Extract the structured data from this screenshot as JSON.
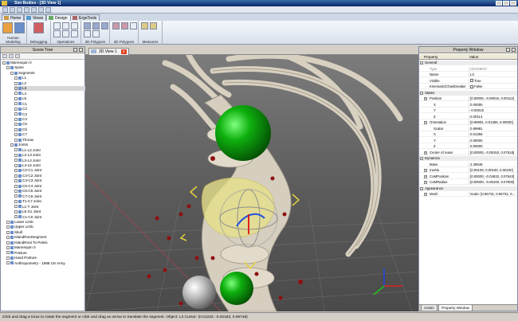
{
  "window": {
    "title": "Sim Bodies - [3D View 1]"
  },
  "tabs": [
    {
      "label": "Home",
      "icon": "home-icon"
    },
    {
      "label": "Views",
      "icon": "views-icon"
    },
    {
      "label": "Design",
      "icon": "design-icon"
    },
    {
      "label": "ErgoTools",
      "icon": "ergotools-icon"
    }
  ],
  "ribbon_groups": [
    "Human Modeling",
    "Debugging",
    "Operations",
    "3D Polygons",
    "3D Polygons",
    "Measures"
  ],
  "scene_tree": {
    "title": "Scene Tree",
    "items": [
      {
        "label": "Mannequin 0",
        "level": 0
      },
      {
        "label": "Spine",
        "level": 1
      },
      {
        "label": "Segments",
        "level": 2
      },
      {
        "label": "L1",
        "level": 3
      },
      {
        "label": "L2",
        "level": 3
      },
      {
        "label": "L3",
        "level": 3,
        "selected": true
      },
      {
        "label": "L4",
        "level": 3
      },
      {
        "label": "L5",
        "level": 3
      },
      {
        "label": "C1",
        "level": 3
      },
      {
        "label": "C2",
        "level": 3
      },
      {
        "label": "C3",
        "level": 3
      },
      {
        "label": "C4",
        "level": 3
      },
      {
        "label": "C5",
        "level": 3
      },
      {
        "label": "C6",
        "level": 3
      },
      {
        "label": "C7",
        "level": 3
      },
      {
        "label": "Thorax",
        "level": 3
      },
      {
        "label": "Joints",
        "level": 2
      },
      {
        "label": "L1-L2 Joint",
        "level": 3
      },
      {
        "label": "L2-L3 Joint",
        "level": 3
      },
      {
        "label": "L3-L4 Joint",
        "level": 3
      },
      {
        "label": "L4-L5 Joint",
        "level": 3
      },
      {
        "label": "C2-C1 Joint",
        "level": 3
      },
      {
        "label": "C3-C2 Joint",
        "level": 3
      },
      {
        "label": "C4-C3 Joint",
        "level": 3
      },
      {
        "label": "C5-C4 Joint",
        "level": 3
      },
      {
        "label": "C6-C5 Joint",
        "level": 3
      },
      {
        "label": "C7-C6 Joint",
        "level": 3
      },
      {
        "label": "T1-C7 Joint",
        "level": 3
      },
      {
        "label": "L1-T Joint",
        "level": 3
      },
      {
        "label": "L5-S1 Joint",
        "level": 3
      },
      {
        "label": "C1-C0 Joint",
        "level": 3
      },
      {
        "label": "Lower Limb",
        "level": 1
      },
      {
        "label": "Upper Limb",
        "level": 1
      },
      {
        "label": "Skull",
        "level": 1
      },
      {
        "label": "IslandRootSegment",
        "level": 1
      },
      {
        "label": "IslandRoot To Pelvis",
        "level": 1
      },
      {
        "label": "Mannequin 0",
        "level": 1
      },
      {
        "label": "Posture",
        "level": 1
      },
      {
        "label": "Hand Posture",
        "level": 1
      },
      {
        "label": "Anthropometry - 1988 US Army",
        "level": 1
      }
    ]
  },
  "view": {
    "tab_label": "3D View 1",
    "close": "x"
  },
  "property_window": {
    "title": "Property Window",
    "col_property": "Property",
    "col_value": "Value",
    "rows": [
      {
        "name": "General",
        "value": "",
        "level": 0,
        "cat": true
      },
      {
        "name": "Type",
        "value": "SEGMENT",
        "level": 1,
        "muted": true
      },
      {
        "name": "Name",
        "value": "L3",
        "level": 1
      },
      {
        "name": "Visible",
        "value": "True",
        "level": 1,
        "check": true
      },
      {
        "name": "Kinematic/Chainbreaker",
        "value": "False",
        "level": 1,
        "check": true
      },
      {
        "name": "States",
        "value": "",
        "level": 0,
        "cat": true
      },
      {
        "name": "Position",
        "value": "[0.00000, -0.00015, 0.00113]",
        "level": 1,
        "exp": true
      },
      {
        "name": "X",
        "value": "0.00000",
        "level": 2
      },
      {
        "name": "Y",
        "value": "-0.00015",
        "level": 2
      },
      {
        "name": "Z",
        "value": "0.00113",
        "level": 2
      },
      {
        "name": "Orientation",
        "value": "[0.99991, 0.01355, 0.00000]",
        "level": 1,
        "exp": true
      },
      {
        "name": "Scalar",
        "value": "0.99991",
        "level": 2
      },
      {
        "name": "X",
        "value": "0.01355",
        "level": 2
      },
      {
        "name": "Y",
        "value": "0.00000",
        "level": 2
      },
      {
        "name": "Z",
        "value": "0.00000",
        "level": 2
      },
      {
        "name": "Center of mass",
        "value": "[0.00000, -0.05153, 0.07618]",
        "level": 1,
        "exp": true
      },
      {
        "name": "Dynamics",
        "value": "",
        "level": 0,
        "cat": true
      },
      {
        "name": "Mass",
        "value": "2.28646",
        "level": 1
      },
      {
        "name": "Inertia",
        "value": "[0.00100, 0.00100, 0.00100]",
        "level": 1,
        "exp": true
      },
      {
        "name": "CoMPosition",
        "value": "[0.00000, -0.04633, 0.07643]",
        "level": 1,
        "exp": true
      },
      {
        "name": "CoMRadius",
        "value": "[0.00000, -0.05100, 0.07900]",
        "level": 1,
        "exp": true
      },
      {
        "name": "Appearance",
        "value": "",
        "level": 0,
        "cat": true
      },
      {
        "name": "Mesh",
        "value": "Scale: [0.96731, 0.96731, 0...",
        "level": 1,
        "exp": true
      }
    ],
    "bottom_tabs": [
      "Action",
      "Property Window"
    ]
  },
  "status": "Click and drag a torus to rotate the segment or click and drag an arrow to translate the segment. Object: L3 Cursor: (0.01233, -0.02163, 0.09748)",
  "colors": {
    "sphere_green": "#0b9a0b",
    "sphere_gray": "#b8b8b8",
    "marker_red": "#8e1010",
    "bone": "#d8d0c0",
    "highlight": "#e6e08a"
  }
}
